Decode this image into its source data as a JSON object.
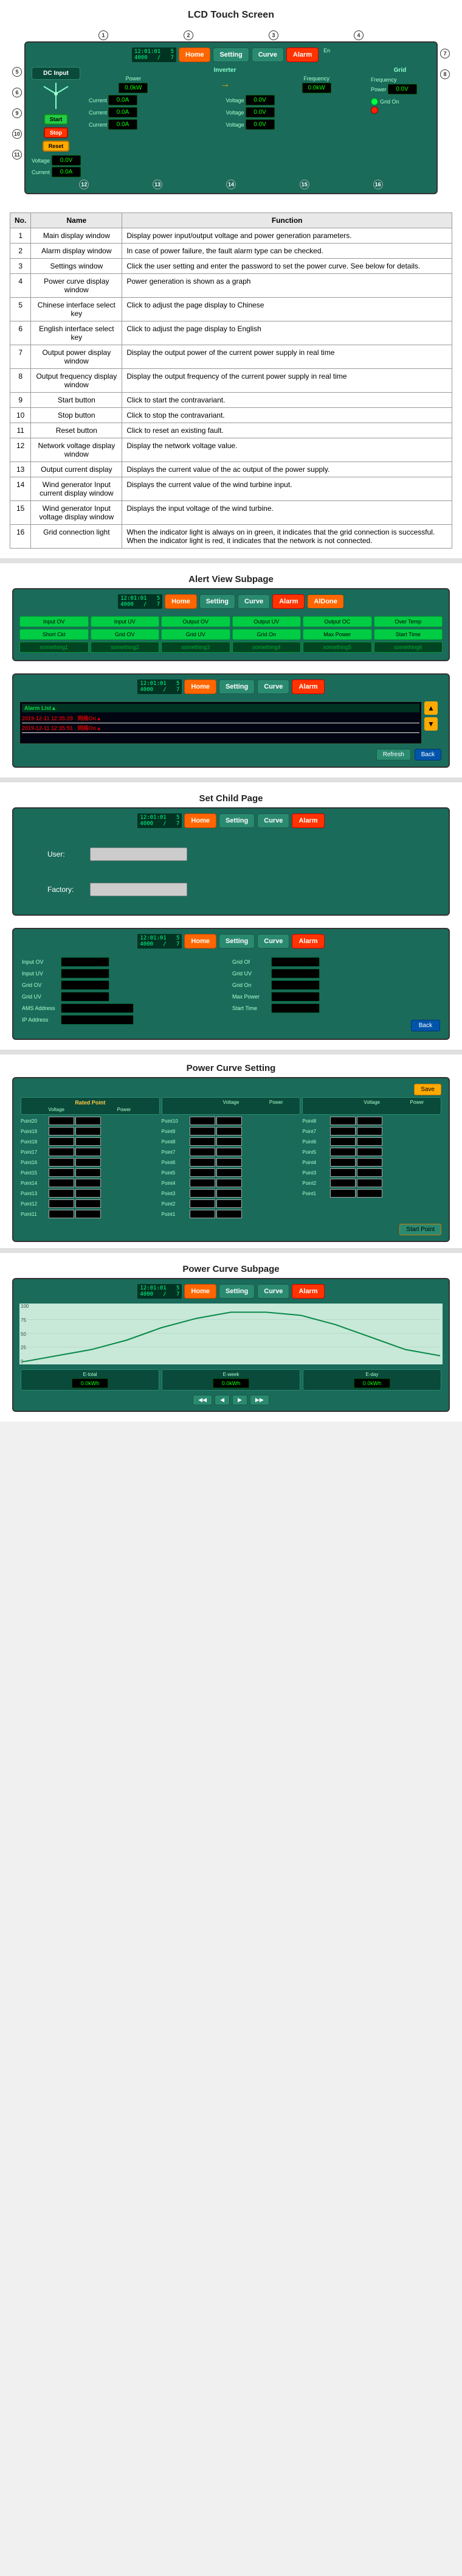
{
  "sections": {
    "lcd_title": "LCD Touch Screen",
    "alert_subpage_title": "Alert View Subpage",
    "set_child_page_title": "Set Child Page",
    "power_curve_setting_title": "Power Curve Setting",
    "power_curve_subpage_title": "Power Curve Subpage"
  },
  "nav": {
    "home": "Home",
    "setting": "Setting",
    "curve": "Curve",
    "alarm": "Alarm"
  },
  "lcd_display": {
    "dc_input": "DC Input",
    "inverter": "Inverter",
    "grid": "Grid",
    "frequency_label": "Frequency",
    "power_label": "Power",
    "voltage_label": "Voltage",
    "current_label": "Current",
    "dc_power_value": "0.0kW",
    "grid_power_value": "0.0kW",
    "values": {
      "v1": "0.0A",
      "v2": "0.0A",
      "v3": "0.0A",
      "v4": "0.0A",
      "v5": "0.0V",
      "v6": "0.0V",
      "v7": "0.0V",
      "v8": "0.0V"
    },
    "start_btn": "Start",
    "stop_btn": "Stop",
    "reset_btn": "Reset"
  },
  "annotations": [
    {
      "num": "1",
      "name": "Main display window",
      "function": "Display power input/output voltage and power generation parameters."
    },
    {
      "num": "2",
      "name": "Alarm display window",
      "function": "In case of power failure, the fault alarm type can be checked."
    },
    {
      "num": "3",
      "name": "Settings window",
      "function": "Click the user setting and enter the password to set the power curve. See below for details."
    },
    {
      "num": "4",
      "name": "Power curve display window",
      "function": "Power generation is shown as a graph"
    },
    {
      "num": "5",
      "name": "Chinese interface select key",
      "function": "Click to adjust the page display to Chinese"
    },
    {
      "num": "6",
      "name": "English interface select key",
      "function": "Click to adjust the page display to English"
    },
    {
      "num": "7",
      "name": "Output power display window",
      "function": "Display the output power of the current power supply in real time"
    },
    {
      "num": "8",
      "name": "Output frequency display window",
      "function": "Display the output frequency of the current power supply in real time"
    },
    {
      "num": "9",
      "name": "Start button",
      "function": "Click to start the contravariant."
    },
    {
      "num": "10",
      "name": "Stop button",
      "function": "Click to stop the contravariant."
    },
    {
      "num": "11",
      "name": "Reset button",
      "function": "Click to reset an existing fault."
    },
    {
      "num": "12",
      "name": "Network voltage display window",
      "function": "Display the network voltage value."
    },
    {
      "num": "13",
      "name": "Output current display",
      "function": "Displays the current value of the ac output of the power supply."
    },
    {
      "num": "14",
      "name": "Wind generator Input current display window",
      "function": "Displays the current value of the wind turbine input."
    },
    {
      "num": "15",
      "name": "Wind generator Input voltage display window",
      "function": "Displays the input voltage of the wind turbine."
    },
    {
      "num": "16",
      "name": "Grid connection light",
      "function": "When the indicator light is always on in green, it indicates that the grid connection is successful. When the indicator light is red, it indicates that the network is not connected."
    }
  ],
  "alert_subpage": {
    "alarms": [
      "Input OV",
      "Input UV",
      "Output OV",
      "Output UV",
      "Output OC",
      "Over Temp",
      "Short Ckt",
      "Grid OV",
      "Grid UV",
      "Grid On",
      "Max Power",
      "Start Time",
      "something1",
      "something2",
      "something3",
      "something4",
      "something5",
      "something6"
    ],
    "back_btn": "Back",
    "log_entries": [
      {
        "time": "2019-12-11 12:35:29",
        "event": "网络On▲",
        "color": "red"
      },
      {
        "time": "2019-12-11 12:35:51",
        "event": "网络On▲",
        "color": "red"
      }
    ],
    "refresh_btn": "Refresh",
    "back_btn2": "Back"
  },
  "set_child_page": {
    "user_label": "User:",
    "factory_label": "Factory:",
    "user_placeholder": "",
    "factory_placeholder": ""
  },
  "settings_page": {
    "fields": [
      {
        "label": "Input OV",
        "value": ""
      },
      {
        "label": "Input UV",
        "value": ""
      },
      {
        "label": "Grid OV",
        "value": ""
      },
      {
        "label": "Grid UV",
        "value": ""
      },
      {
        "label": "AMS Address",
        "value": ""
      },
      {
        "label": "IP Address",
        "value": ""
      },
      {
        "label": "Grid Of",
        "value": ""
      },
      {
        "label": "Grid UV",
        "value": ""
      },
      {
        "label": "Grid On",
        "value": ""
      },
      {
        "label": "Max Power",
        "value": ""
      },
      {
        "label": "Start Time",
        "value": ""
      }
    ],
    "back_btn": "Back"
  },
  "power_curve_setting": {
    "rated_point_label": "Rated Point",
    "voltage_header": "Voltage",
    "power_header": "Power",
    "start_point_btn": "Start Point",
    "points_left": [
      "Point20",
      "Point19",
      "Point18",
      "Point17",
      "Point16",
      "Point15",
      "Point14",
      "Point13",
      "Point12",
      "Point11"
    ],
    "points_center": [
      "Point10",
      "Point9",
      "Point8",
      "Point7",
      "Point6",
      "Point5",
      "Point4",
      "Point3",
      "Point2",
      "Point1"
    ],
    "points_right": [
      "Point8",
      "Point7",
      "Point6",
      "Point5",
      "Point4",
      "Point3",
      "Point2",
      "Point1"
    ],
    "save_btn": "Save"
  },
  "power_curve_subpage": {
    "chart_points": [
      0,
      10,
      20,
      35,
      55,
      70,
      80,
      80,
      75,
      60,
      40,
      20,
      10
    ],
    "bottom_values": [
      "0.0kWh",
      "0.0kWh",
      "0.0kWh"
    ],
    "bottom_labels": [
      "E-total",
      "E-week",
      "E-day"
    ]
  },
  "colors": {
    "teal_bg": "#1a6b5a",
    "dark_teal": "#0d4a3a",
    "green_btn": "#22cc44",
    "red_btn": "#ff3300",
    "orange_btn": "#ffaa00",
    "nav_orange": "#ff6600",
    "green_indicator": "#00ff44",
    "value_green": "#00ff00"
  }
}
